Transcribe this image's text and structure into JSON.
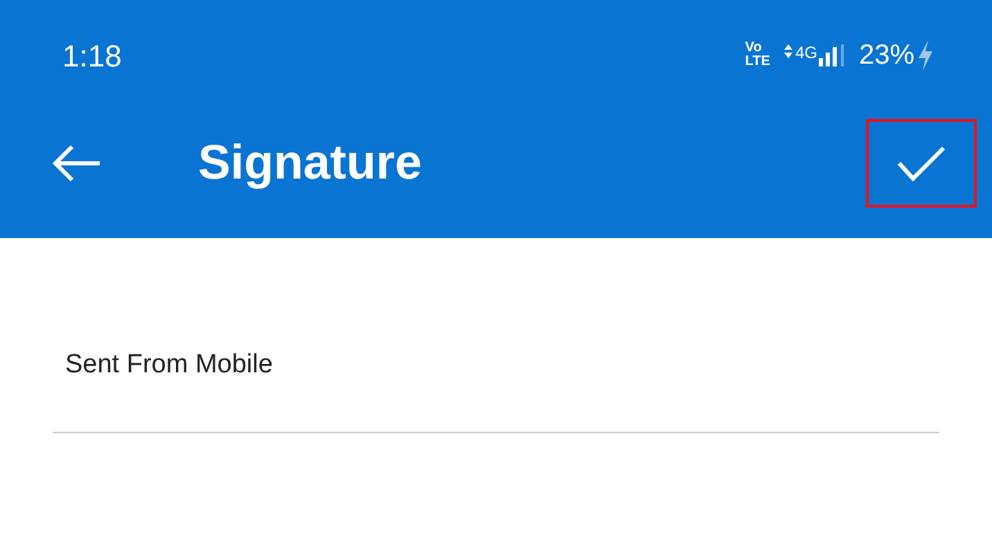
{
  "status_bar": {
    "time": "1:18",
    "volte": [
      "Vo",
      "LTE"
    ],
    "network": "4G",
    "battery": "23%",
    "charging": true
  },
  "app_bar": {
    "title": "Signature",
    "confirm_highlighted": true
  },
  "signature_field": {
    "value": "Sent From Mobile"
  }
}
